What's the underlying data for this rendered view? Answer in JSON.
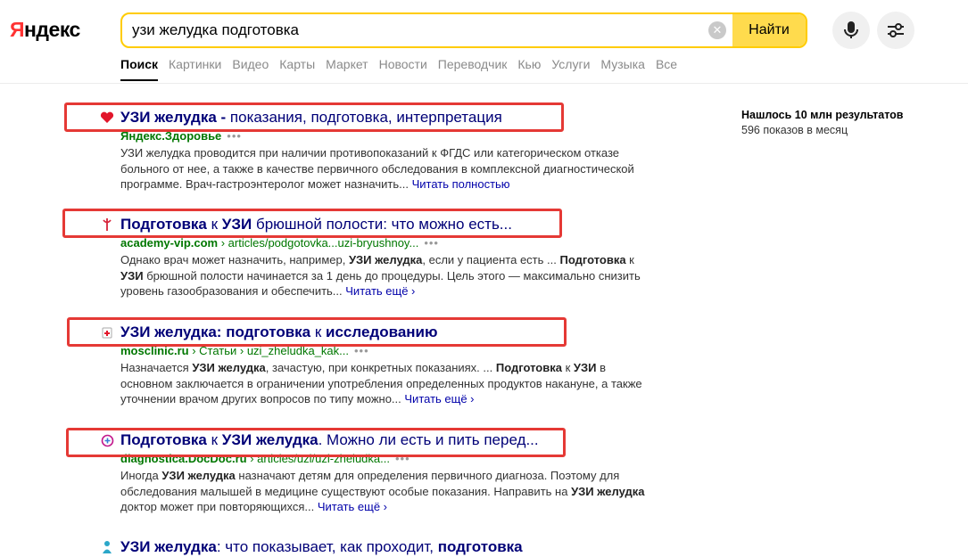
{
  "header": {
    "logo_first": "Я",
    "logo_rest": "ндекс",
    "search_value": "узи желудка подготовка",
    "find_label": "Найти"
  },
  "tabs": [
    "Поиск",
    "Картинки",
    "Видео",
    "Карты",
    "Маркет",
    "Новости",
    "Переводчик",
    "Кью",
    "Услуги",
    "Музыка",
    "Все"
  ],
  "sidebar": {
    "found": "Нашлось 10 млн результатов",
    "shows": "596 показов в месяц"
  },
  "colors": {
    "search_border": "#ffcc00",
    "find_button": "#ffdb4d",
    "title_link": "#000077",
    "url_green": "#007700",
    "highlight_box": "#e53935"
  },
  "results": [
    {
      "favicon": "heart-icon",
      "title": [
        {
          "t": "УЗИ желудка - ",
          "b": true
        },
        {
          "t": "показания, подготовка, интерпретация",
          "b": false
        }
      ],
      "domain": "Яндекс.Здоровье",
      "path": "",
      "text": [
        {
          "t": "УЗИ желудка проводится при наличии противопоказаний к ФГДС или категорическом отказе больного от нее, а также в качестве первичного обследования в комплексной диагностической программе. Врач-гастроэнтеролог может назначить...",
          "b": false
        }
      ],
      "more": "Читать полностью"
    },
    {
      "favicon": "academy-icon",
      "title": [
        {
          "t": "Подготовка",
          "b": true
        },
        {
          "t": " к ",
          "b": false
        },
        {
          "t": "УЗИ",
          "b": true
        },
        {
          "t": " брюшной полости: что можно есть...",
          "b": false
        }
      ],
      "domain": "academy-vip.com",
      "path": " › articles/podgotovka...uzi-bryushnoy...",
      "text": [
        {
          "t": "Однако врач может назначить, например, ",
          "b": false
        },
        {
          "t": "УЗИ желудка",
          "b": true
        },
        {
          "t": ", если у пациента есть ... ",
          "b": false
        },
        {
          "t": "Подготовка",
          "b": true
        },
        {
          "t": " к ",
          "b": false
        },
        {
          "t": "УЗИ",
          "b": true
        },
        {
          "t": " брюшной полости начинается за 1 день до процедуры. Цель этого — максимально снизить уровень газообразования и обеспечить...",
          "b": false
        }
      ],
      "more": "Читать ещё ›"
    },
    {
      "favicon": "clinic-icon",
      "title": [
        {
          "t": "УЗИ желудка: подготовка",
          "b": true
        },
        {
          "t": " к ",
          "b": false
        },
        {
          "t": "исследованию",
          "b": true
        }
      ],
      "domain": "mosclinic.ru",
      "path": " › Статьи › uzi_zheludka_kak...",
      "text": [
        {
          "t": "Назначается ",
          "b": false
        },
        {
          "t": "УЗИ желудка",
          "b": true
        },
        {
          "t": ", зачастую, при конкретных показаниях. ... ",
          "b": false
        },
        {
          "t": "Подготовка",
          "b": true
        },
        {
          "t": " к ",
          "b": false
        },
        {
          "t": "УЗИ",
          "b": true
        },
        {
          "t": " в основном заключается в ограничении употребления определенных продуктов накануне, а также уточнении врачом других вопросов по типу можно...",
          "b": false
        }
      ],
      "more": "Читать ещё ›"
    },
    {
      "favicon": "plus-circle-icon",
      "title": [
        {
          "t": "Подготовка",
          "b": true
        },
        {
          "t": " к ",
          "b": false
        },
        {
          "t": "УЗИ желудка",
          "b": true
        },
        {
          "t": ". Можно ли есть и пить перед...",
          "b": false
        }
      ],
      "domain": "diagnostica.DocDoc.ru",
      "path": " › articles/uzi/uzi-zheludka...",
      "text": [
        {
          "t": "Иногда ",
          "b": false
        },
        {
          "t": "УЗИ желудка",
          "b": true
        },
        {
          "t": " назначают детям для определения первичного диагноза. Поэтому для обследования малышей в медицине существуют особые показания. Направить на ",
          "b": false
        },
        {
          "t": "УЗИ желудка",
          "b": true
        },
        {
          "t": " доктор может при повторяющихся...",
          "b": false
        }
      ],
      "more": "Читать ещё ›"
    },
    {
      "favicon": "person-icon",
      "title": [
        {
          "t": "УЗИ желудка",
          "b": true
        },
        {
          "t": ": что показывает, как проходит, ",
          "b": false
        },
        {
          "t": "подготовка",
          "b": true
        }
      ],
      "domain": "",
      "path": "",
      "text": [],
      "more": ""
    }
  ]
}
